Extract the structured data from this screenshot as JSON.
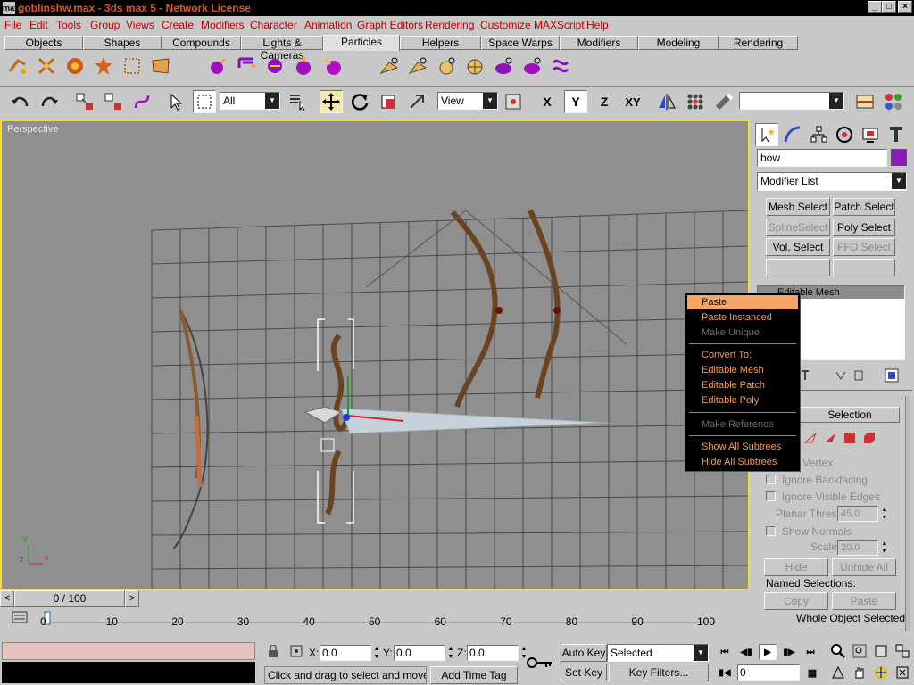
{
  "window": {
    "title": "goblinshw.max - 3ds max 5 - Network License",
    "logo": "max",
    "min": "_",
    "max": "□",
    "close": "×"
  },
  "menu": [
    "File",
    "Edit",
    "Tools",
    "Group",
    "Views",
    "Create",
    "Modifiers",
    "Character",
    "Animation",
    "Graph Editors",
    "Rendering",
    "Customize",
    "MAXScript",
    "Help"
  ],
  "tabs": [
    "Objects",
    "Shapes",
    "Compounds",
    "Lights & Cameras",
    "Particles",
    "Helpers",
    "Space Warps",
    "Modifiers",
    "Modeling",
    "Rendering"
  ],
  "active_tab": "Particles",
  "toolbar": {
    "filter": "All",
    "refcoord": "View",
    "axes": [
      "X",
      "Y",
      "Z",
      "XY"
    ],
    "named_sel": ""
  },
  "viewport": {
    "label": "Perspective",
    "axis_y": "y",
    "axis_x": "x",
    "axis_z": "z"
  },
  "cmdpanel": {
    "object_name": "bow",
    "object_color": "#8c1ab4",
    "modifier_list": "Modifier List",
    "mod_buttons": [
      {
        "label": "Mesh Select",
        "enabled": true
      },
      {
        "label": "Patch Select",
        "enabled": true
      },
      {
        "label": "SplineSelect",
        "enabled": false
      },
      {
        "label": "Poly Select",
        "enabled": true
      },
      {
        "label": "Vol. Select",
        "enabled": true
      },
      {
        "label": "FFD Select",
        "enabled": false
      },
      {
        "label": "",
        "enabled": true
      },
      {
        "label": "",
        "enabled": true
      }
    ],
    "stack_item": "Editable Mesh",
    "rollout_title": "Selection",
    "by_vertex": "By Vertex",
    "ignore_backfacing": "Ignore Backfacing",
    "ignore_visible_edges": "Ignore Visible Edges",
    "planar_thresh_label": "Planar Thresh:",
    "planar_thresh": "45.0",
    "show_normals": "Show Normals",
    "scale_label": "Scale:",
    "scale": "20.0",
    "hide": "Hide",
    "unhide_all": "Unhide All",
    "named_selections": "Named Selections:",
    "copy": "Copy",
    "paste": "Paste",
    "whole_object": "Whole Object Selected"
  },
  "context_menu": [
    {
      "label": "Paste",
      "state": "highlight"
    },
    {
      "label": "Paste Instanced",
      "state": "normal"
    },
    {
      "label": "Make Unique",
      "state": "disabled"
    },
    {
      "sep": true
    },
    {
      "label": "Convert To:",
      "state": "normal"
    },
    {
      "label": "Editable Mesh",
      "state": "normal"
    },
    {
      "label": "Editable Patch",
      "state": "normal"
    },
    {
      "label": "Editable Poly",
      "state": "normal"
    },
    {
      "sep": true
    },
    {
      "label": "Make Reference",
      "state": "disabled"
    },
    {
      "sep": true
    },
    {
      "label": "Show All Subtrees",
      "state": "normal"
    },
    {
      "label": "Hide All Subtrees",
      "state": "normal"
    }
  ],
  "timeline": {
    "frame": "0 / 100",
    "prev": "<",
    "next": ">",
    "ticks": [
      "0",
      "10",
      "20",
      "30",
      "40",
      "50",
      "60",
      "70",
      "80",
      "90",
      "100"
    ]
  },
  "status": {
    "x_label": "X:",
    "x": "0.0",
    "y_label": "Y:",
    "y": "0.0",
    "z_label": "Z:",
    "z": "0.0",
    "prompt": "Click and drag to select and move obj",
    "add_time_tag": "Add Time Tag",
    "auto_key": "Auto Key",
    "set_key": "Set Key",
    "selected": "Selected",
    "key_filters": "Key Filters...",
    "frame_field": "0"
  }
}
